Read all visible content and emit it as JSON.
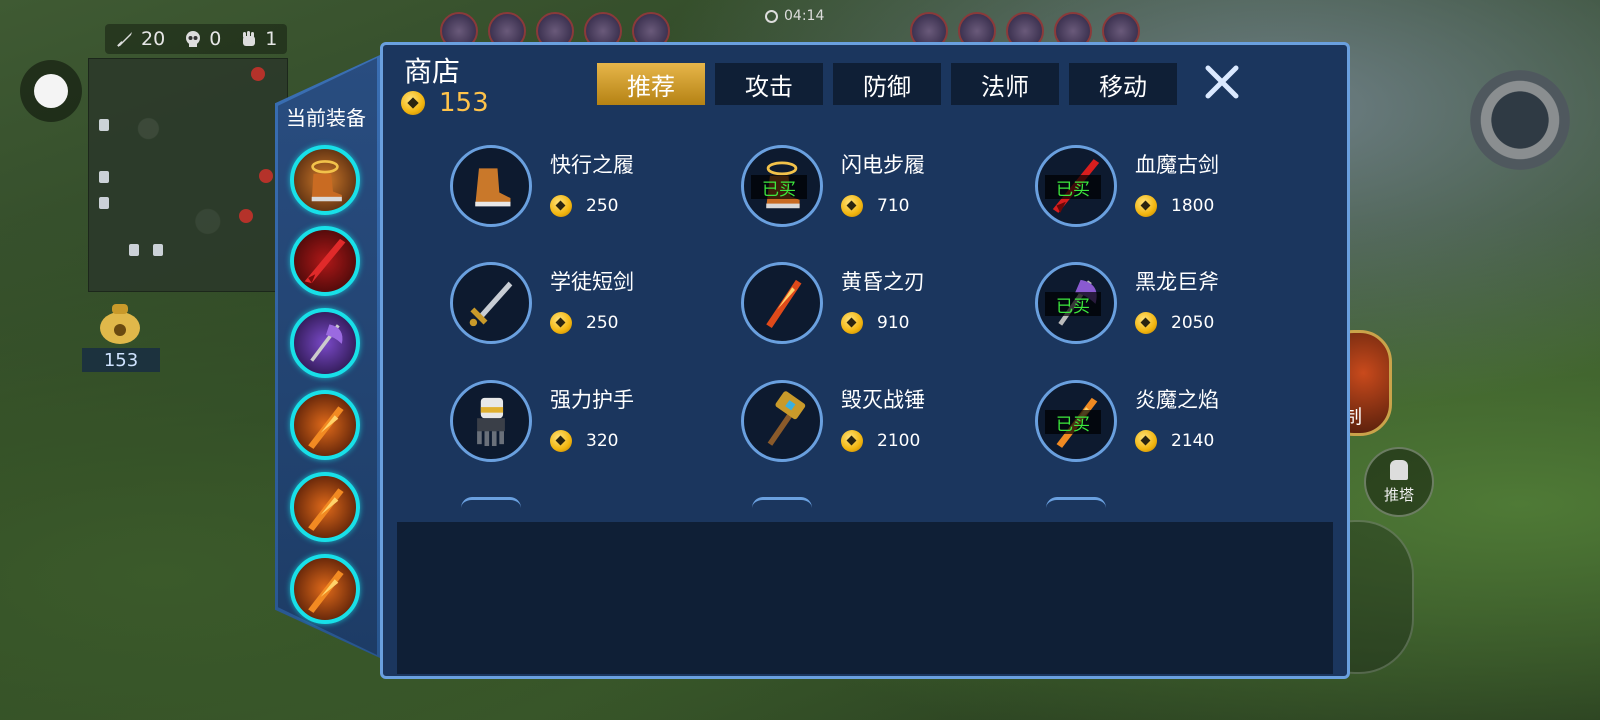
{
  "hud": {
    "kills": "20",
    "deaths": "0",
    "assists": "1",
    "time": "04:14",
    "gold_left": "153",
    "right_skill_label": "控制",
    "push_label": "推塔"
  },
  "equip_panel": {
    "title": "当前装备"
  },
  "shop": {
    "title": "商店",
    "gold": "153",
    "tabs": [
      "推荐",
      "攻击",
      "防御",
      "法师",
      "移动"
    ],
    "active_tab": "推荐",
    "bought_label": "已买",
    "items": [
      {
        "name": "快行之履",
        "price": "250",
        "bought": false,
        "icon": "boots-icon"
      },
      {
        "name": "闪电步履",
        "price": "710",
        "bought": true,
        "icon": "lightning-boots-icon"
      },
      {
        "name": "血魔古剑",
        "price": "1800",
        "bought": true,
        "icon": "blood-sword-icon"
      },
      {
        "name": "学徒短剑",
        "price": "250",
        "bought": false,
        "icon": "short-sword-icon"
      },
      {
        "name": "黄昏之刃",
        "price": "910",
        "bought": false,
        "icon": "twilight-blade-icon"
      },
      {
        "name": "黑龙巨斧",
        "price": "2050",
        "bought": true,
        "icon": "black-dragon-axe-icon"
      },
      {
        "name": "强力护手",
        "price": "320",
        "bought": false,
        "icon": "gauntlet-icon"
      },
      {
        "name": "毁灭战锤",
        "price": "2100",
        "bought": false,
        "icon": "war-hammer-icon"
      },
      {
        "name": "炎魔之焰",
        "price": "2140",
        "bought": true,
        "icon": "flame-blade-icon"
      }
    ]
  }
}
